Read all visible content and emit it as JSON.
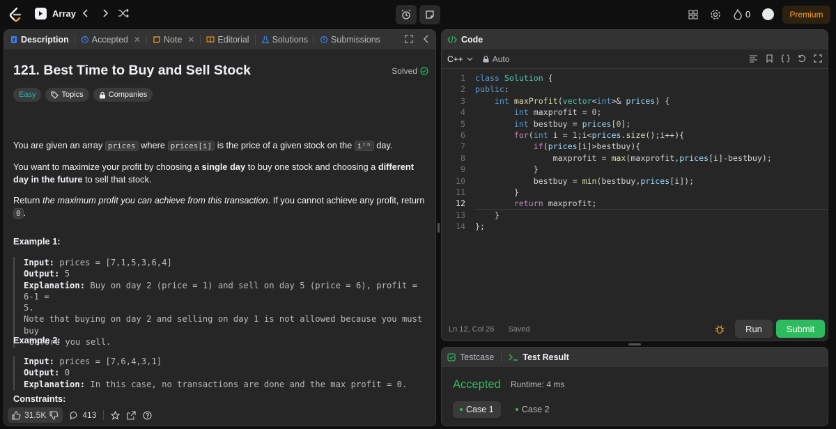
{
  "nav": {
    "list_title": "Array",
    "streak_count": "0",
    "premium_label": "Premium"
  },
  "left_tabs": [
    {
      "label": "Description"
    },
    {
      "label": "Accepted"
    },
    {
      "label": "Note"
    },
    {
      "label": "Editorial"
    },
    {
      "label": "Solutions"
    },
    {
      "label": "Submissions"
    }
  ],
  "problem": {
    "title": "121. Best Time to Buy and Sell Stock",
    "status": "Solved",
    "difficulty": "Easy",
    "topics_label": "Topics",
    "companies_label": "Companies",
    "p1_a": "You are given an array ",
    "p1_code1": "prices",
    "p1_b": " where ",
    "p1_code2": "prices[i]",
    "p1_c": " is the price of a given stock on the ",
    "p1_code3": "iᵗʰ",
    "p1_d": " day.",
    "p2_a": "You want to maximize your profit by choosing a ",
    "p2_b1": "single day",
    "p2_c": " to buy one stock and choosing a ",
    "p2_b2": "different day in the future",
    "p2_d": " to sell that stock.",
    "p3_a": "Return ",
    "p3_i": "the maximum profit you can achieve from this transaction",
    "p3_b": ". If you cannot achieve any profit, return ",
    "p3_code": "0",
    "p3_c": ".",
    "ex1_head": "Example 1:",
    "ex1_input_label": "Input:",
    "ex1_input": " prices = [7,1,5,3,6,4]",
    "ex1_output_label": "Output:",
    "ex1_output": " 5",
    "ex1_expl_label": "Explanation:",
    "ex1_expl": " Buy on day 2 (price = 1) and sell on day 5 (price = 6), profit = 6-1 =",
    "ex1_expl2": "5.",
    "ex1_note1": "Note that buying on day 2 and selling on day 1 is not allowed because you must buy",
    "ex1_note2": "before you sell.",
    "ex2_head": "Example 2:",
    "ex2_input_label": "Input:",
    "ex2_input": " prices = [7,6,4,3,1]",
    "ex2_output_label": "Output:",
    "ex2_output": " 0",
    "ex2_expl_label": "Explanation:",
    "ex2_expl": " In this case, no transactions are done and the max profit = 0.",
    "constraints_head": "Constraints:"
  },
  "footer": {
    "likes": "31.5K",
    "comments": "413"
  },
  "code_panel": {
    "title": "Code",
    "language": "C++",
    "mode": "Auto",
    "cursor_pos": "Ln 12, Col 26",
    "save_status": "Saved",
    "run_label": "Run",
    "submit_label": "Submit",
    "line_numbers": [
      "1",
      "2",
      "3",
      "4",
      "5",
      "6",
      "7",
      "8",
      "9",
      "10",
      "11",
      "12",
      "13",
      "14"
    ]
  },
  "test_panel": {
    "testcase_label": "Testcase",
    "result_label": "Test Result",
    "verdict": "Accepted",
    "runtime": "Runtime: 4 ms",
    "cases": [
      "Case 1",
      "Case 2"
    ]
  },
  "colors": {
    "accent_green": "#2cbb5d",
    "easy": "#1cbaba",
    "premium": "#ffa116"
  }
}
